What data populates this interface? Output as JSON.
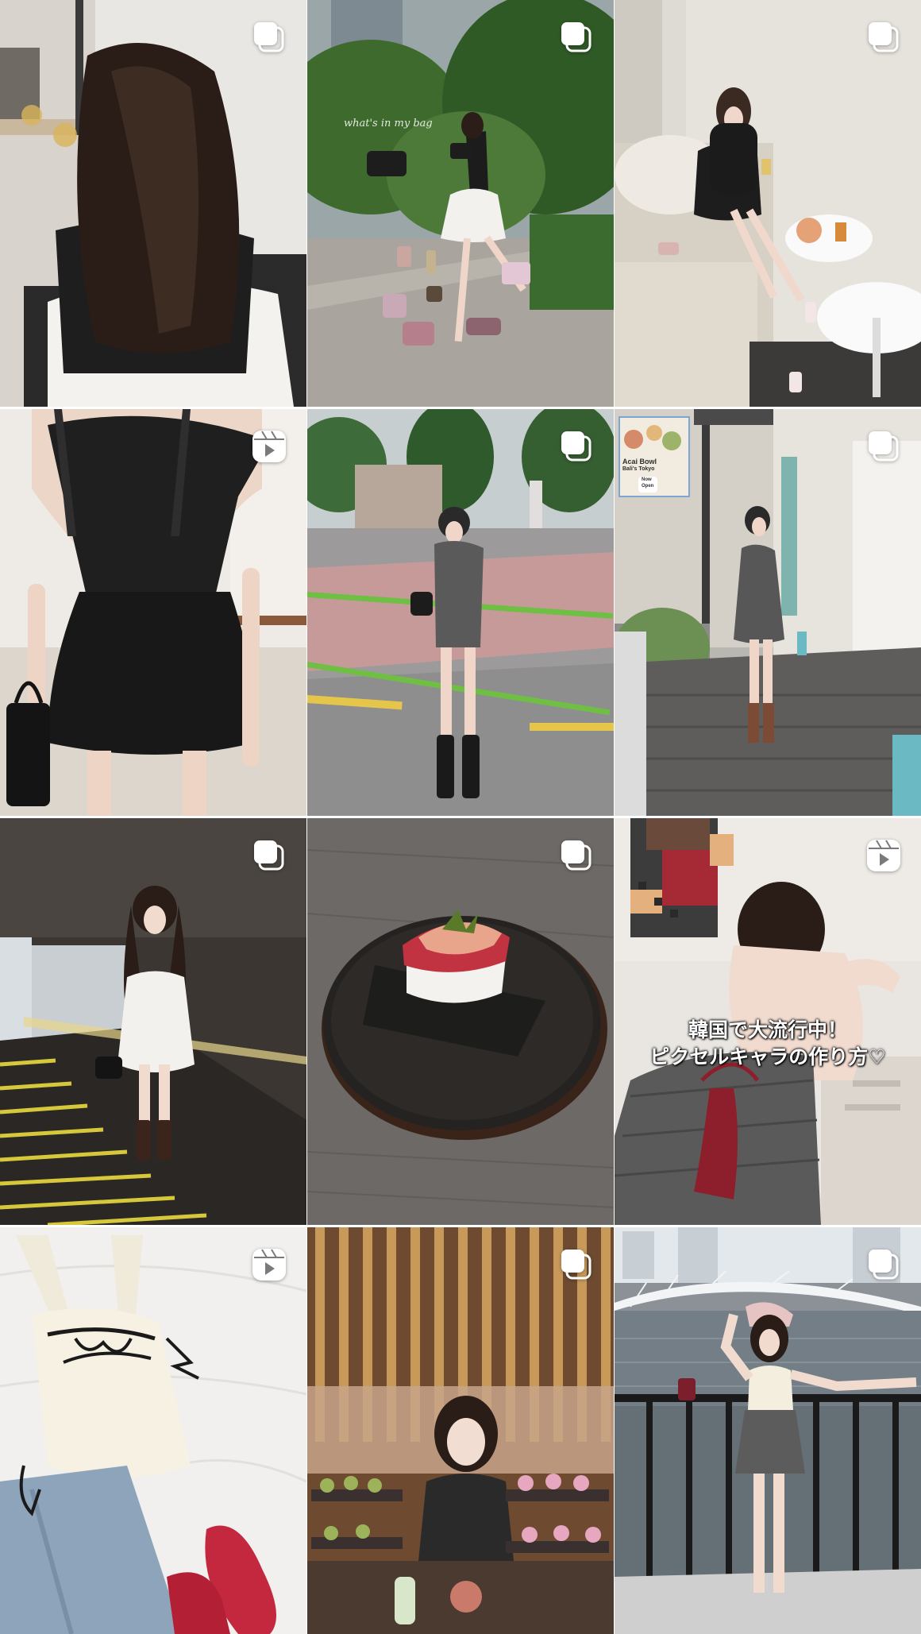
{
  "colors": {
    "badge": "#ffffff",
    "background": "#ffffff"
  },
  "grid": {
    "posts": [
      {
        "id": "p1",
        "type": "carousel",
        "badge_icon": "carousel-icon",
        "description_subject": "long straight dark hair"
      },
      {
        "id": "p2",
        "type": "carousel",
        "badge_icon": "carousel-icon",
        "overlay_text": "what's in my bag"
      },
      {
        "id": "p3",
        "type": "carousel",
        "badge_icon": "carousel-icon"
      },
      {
        "id": "p4",
        "type": "reel",
        "badge_icon": "reels-icon"
      },
      {
        "id": "p5",
        "type": "carousel",
        "badge_icon": "carousel-icon"
      },
      {
        "id": "p6",
        "type": "carousel",
        "badge_icon": "carousel-icon",
        "sign_lines": [
          "Acai Bowl",
          "Bali's Tokyo",
          "Now",
          "Open"
        ]
      },
      {
        "id": "p7",
        "type": "carousel",
        "badge_icon": "carousel-icon"
      },
      {
        "id": "p8",
        "type": "carousel",
        "badge_icon": "carousel-icon"
      },
      {
        "id": "p9",
        "type": "reel",
        "badge_icon": "reels-icon",
        "caption_lines": [
          "韓国で大流行中！",
          "ピクセルキャラの作り方♡"
        ]
      },
      {
        "id": "p10",
        "type": "reel",
        "badge_icon": "reels-icon"
      },
      {
        "id": "p11",
        "type": "carousel",
        "badge_icon": "carousel-icon"
      },
      {
        "id": "p12",
        "type": "carousel",
        "badge_icon": "carousel-icon"
      }
    ]
  }
}
